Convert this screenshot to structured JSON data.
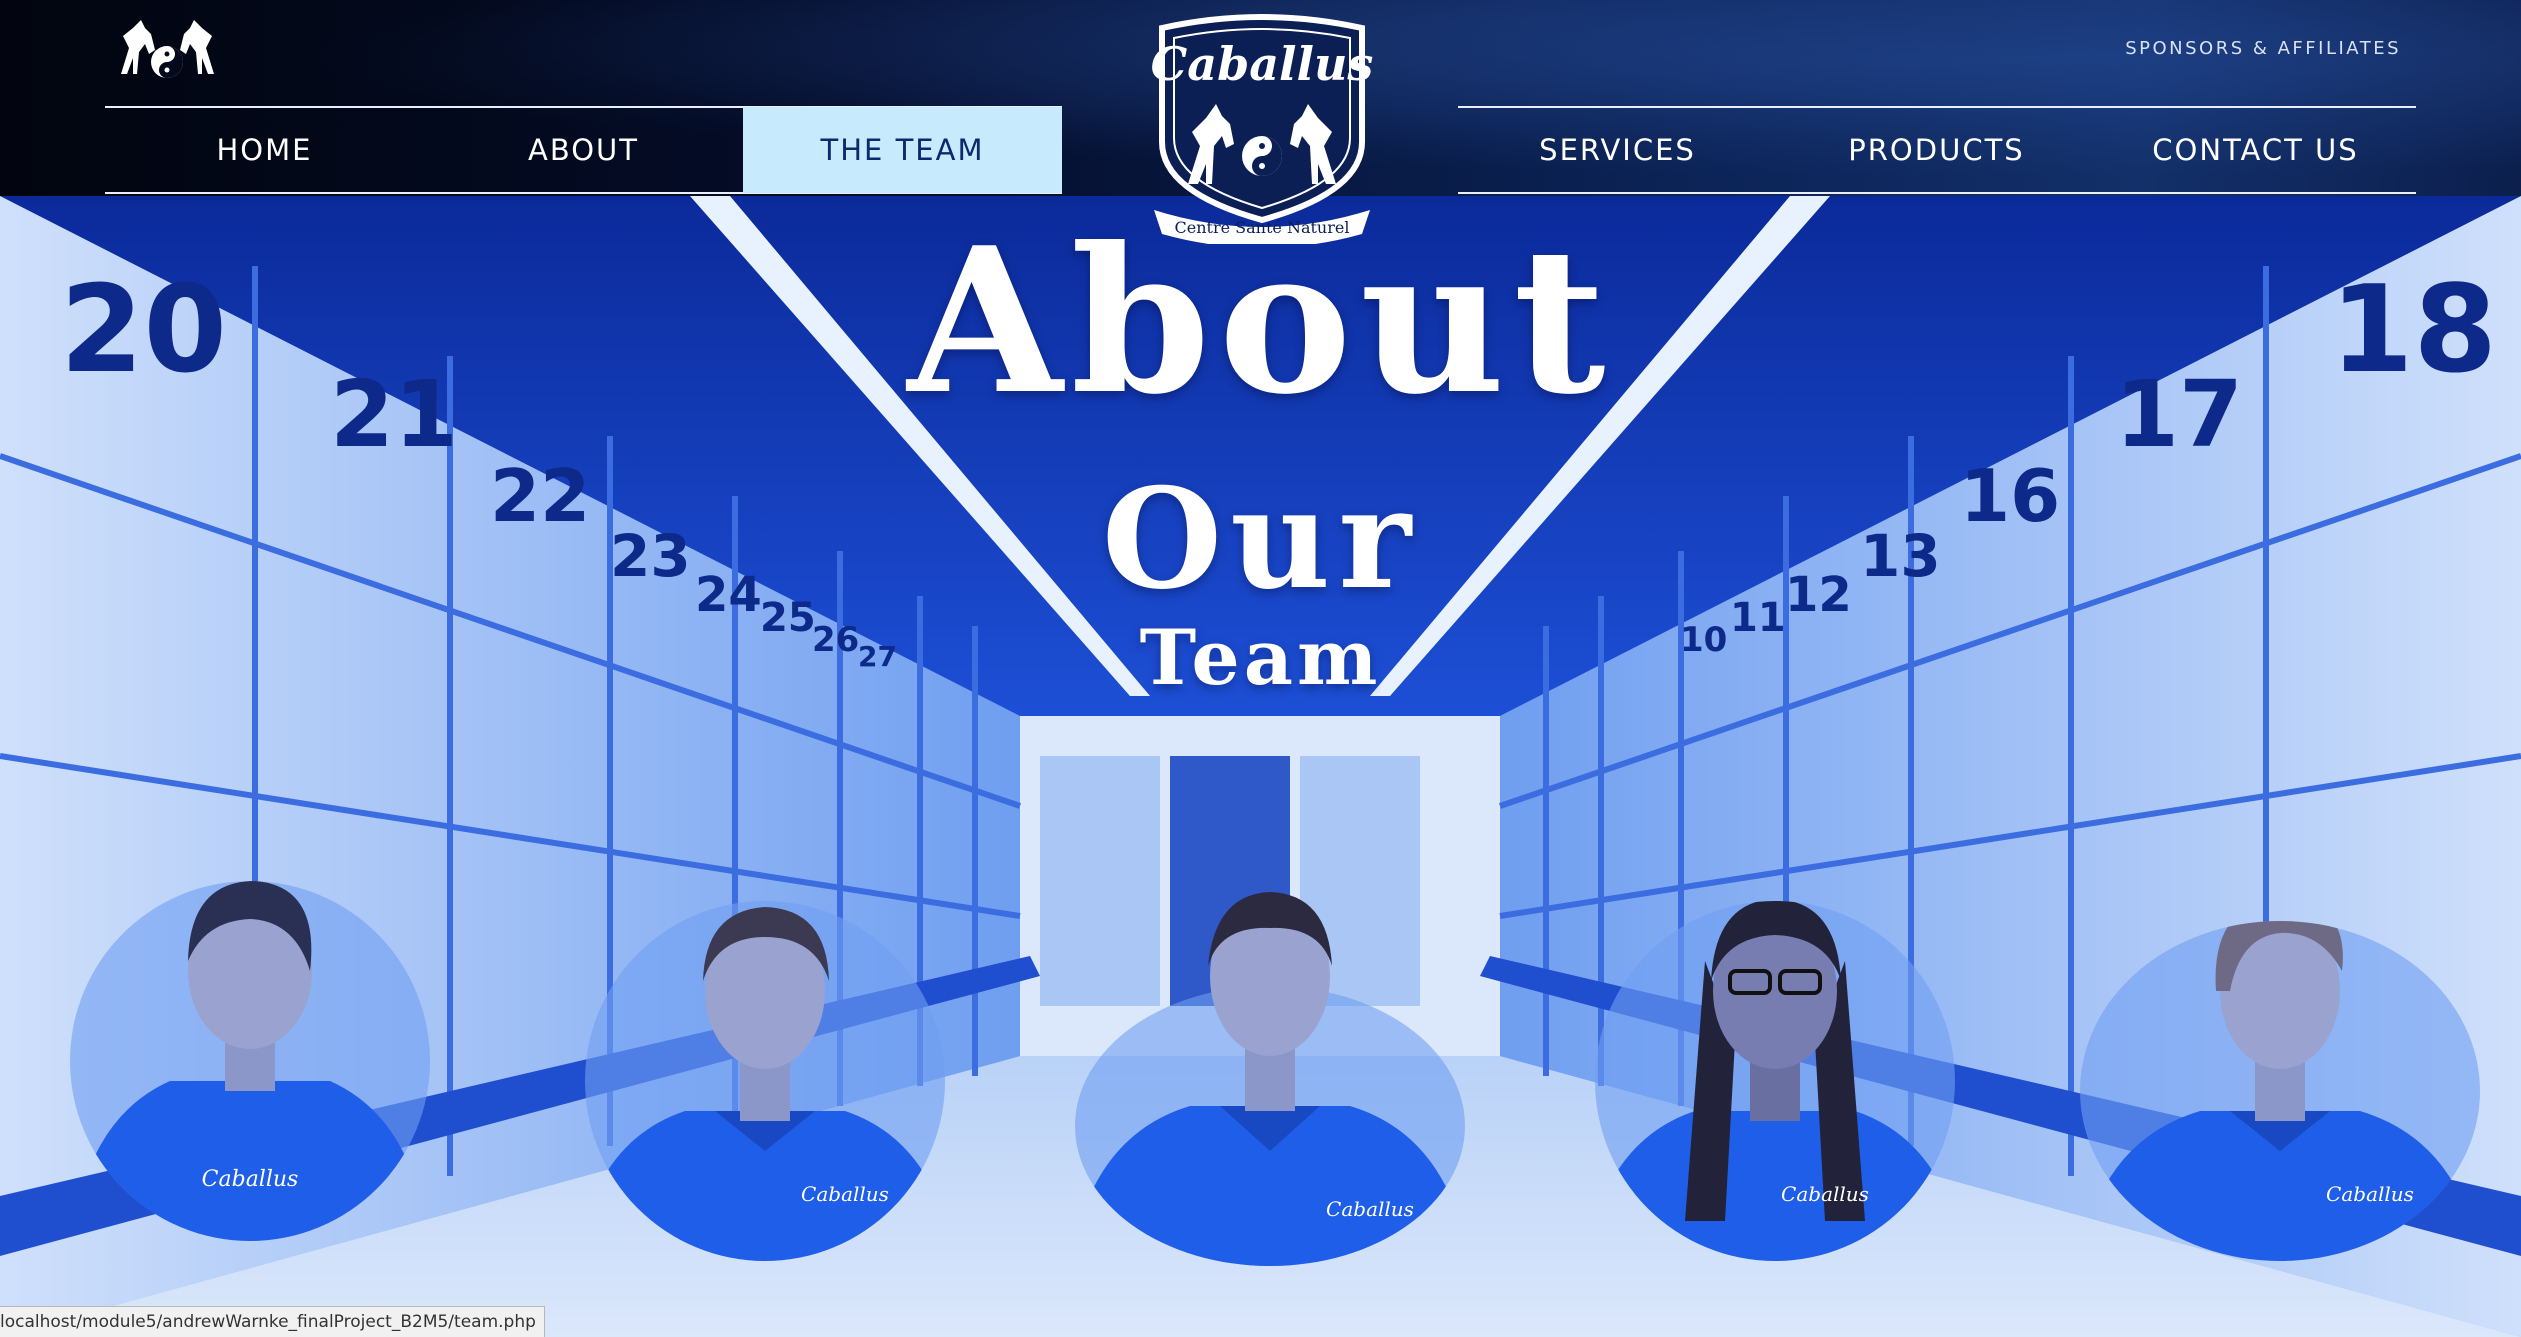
{
  "header": {
    "sponsors_label": "SPONSORS & AFFILIATES",
    "nav_left": [
      "HOME",
      "ABOUT",
      "THE TEAM"
    ],
    "nav_right": [
      "SERVICES",
      "PRODUCTS",
      "CONTACT US"
    ],
    "active_item": "THE TEAM",
    "logo": {
      "brand": "Caballus",
      "tagline": "Centre Santé Naturel"
    }
  },
  "hero": {
    "title_line1": "About",
    "title_line2": "Our",
    "title_line3": "Team",
    "locker_numbers_left": [
      "20",
      "21",
      "22",
      "23",
      "24",
      "25",
      "26",
      "27"
    ],
    "locker_numbers_right": [
      "18",
      "17",
      "16",
      "13",
      "12",
      "11",
      "10"
    ],
    "shirt_logo_text": "Caballus"
  },
  "team": [
    {
      "id": "member-1",
      "label": "team-member-1"
    },
    {
      "id": "member-2",
      "label": "team-member-2"
    },
    {
      "id": "member-3",
      "label": "team-member-3"
    },
    {
      "id": "member-4",
      "label": "team-member-4"
    },
    {
      "id": "member-5",
      "label": "team-member-5"
    }
  ],
  "status_bar": {
    "url": "localhost/module5/andrewWarnke_finalProject_B2M5/team.php"
  },
  "colors": {
    "header_bg": "#040d2a",
    "nav_active_bg": "#c7eafc",
    "nav_active_text": "#0a2a6b",
    "hero_blue": "#1c4bd6",
    "shirt_blue": "#1f5ee8"
  }
}
